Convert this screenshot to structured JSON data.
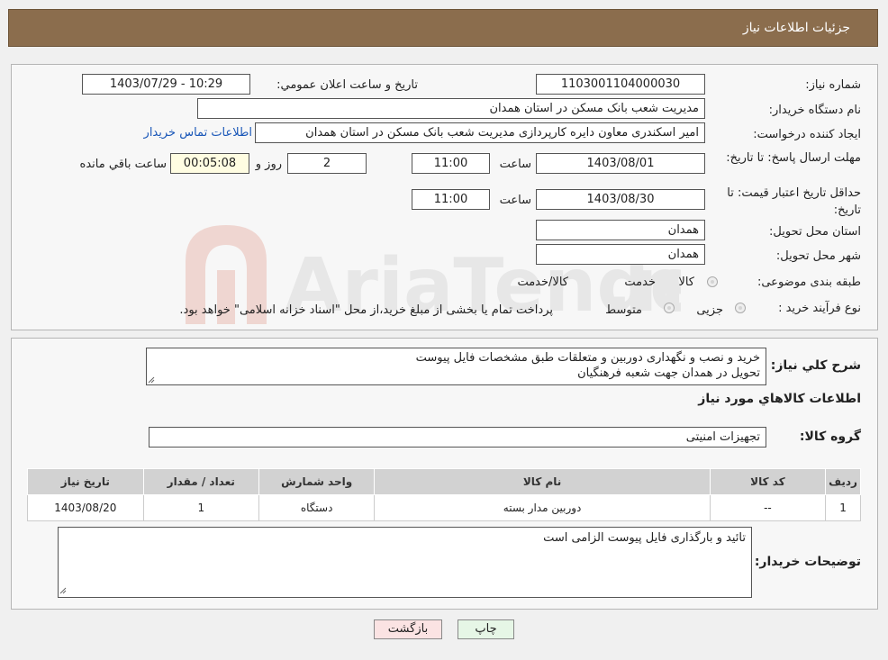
{
  "header": {
    "title": "جزئیات اطلاعات نیاز"
  },
  "info": {
    "need_number_label": "شماره نیاز:",
    "need_number": "1103001104000030",
    "announce_label": "تاریخ و ساعت اعلان عمومي:",
    "announce_value": "1403/07/29 - 10:29",
    "buyer_org_label": "نام دستگاه خريدار:",
    "buyer_org": "مديريت شعب بانک مسکن در استان همدان",
    "creator_label": "ایجاد کننده درخواست:",
    "creator": "امير اسکندری معاون دايره کارپردازی مديريت شعب بانک مسکن در استان همدان",
    "contact_link": "اطلاعات تماس خريدار",
    "reply_deadline_label": "مهلت ارسال پاسخ: تا تاریخ:",
    "reply_date": "1403/08/01",
    "time_label": "ساعت",
    "reply_time": "11:00",
    "days_value": "2",
    "days_label": "روز و",
    "remaining_time": "00:05:08",
    "remaining_label": "ساعت باقي مانده",
    "price_valid_label": "حداقل تاریخ اعتبار قیمت: تا تاریخ:",
    "price_valid_date": "1403/08/30",
    "price_valid_time": "11:00",
    "province_label": "استان محل تحویل:",
    "province": "همدان",
    "city_label": "شهر محل تحویل:",
    "city": "همدان",
    "category_label": "طبقه بندی موضوعی:",
    "category_options": [
      "کالا",
      "خدمت",
      "کالا/خدمت"
    ],
    "process_label": "نوع فرآیند خرید :",
    "process_options": [
      "جزیی",
      "متوسط"
    ],
    "process_note": "پرداخت تمام یا بخشی از مبلغ خرید،از محل \"اسناد خزانه اسلامی\" خواهد بود."
  },
  "details": {
    "summary_label": "شرح کلي نياز:",
    "summary_lines": [
      "خريد و نصب و نگهداری دوربين و متعلقات طبق مشخصات فايل پيوست",
      "تحويل در همدان جهت شعبه فرهنگيان"
    ],
    "goods_info_title": "اطلاعات کالاهاي مورد نياز",
    "goods_group_label": "گروه کالا:",
    "goods_group": "تجهيزات امنيتی",
    "table": {
      "headers": [
        "رديف",
        "کد کالا",
        "نام کالا",
        "واحد شمارش",
        "تعداد / مقدار",
        "تاريخ نياز"
      ],
      "rows": [
        [
          "1",
          "--",
          "دوربين مدار بسته",
          "دستگاه",
          "1",
          "1403/08/20"
        ]
      ]
    },
    "buyer_notes_label": "توضيحات خريدار:",
    "buyer_notes": "تائيد و بارگذاری فايل پيوست الزامی است"
  },
  "buttons": {
    "print": "چاپ",
    "back": "بازگشت"
  },
  "colors": {
    "header": "#8b6d4d",
    "link": "#1a57b8",
    "print_bg": "#e6f6e6",
    "back_bg": "#fbe3e3"
  }
}
